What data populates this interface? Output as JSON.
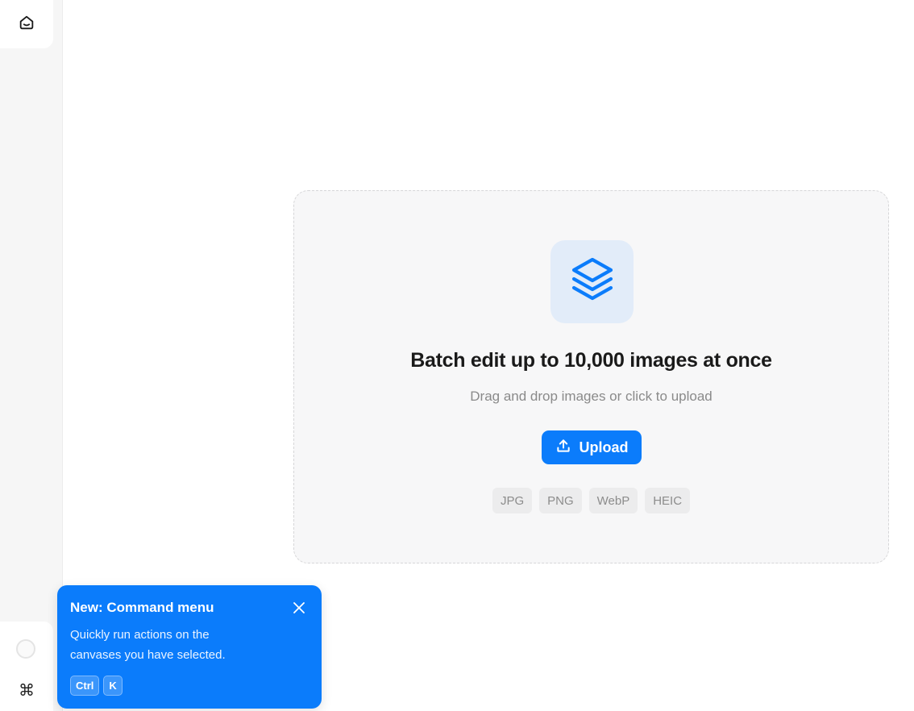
{
  "sidebar": {
    "home_icon": "home-icon",
    "status_icon": "status-ring-icon",
    "command_glyph": "⌘"
  },
  "dropzone": {
    "icon": "layers-icon",
    "title": "Batch edit up to 10,000 images at once",
    "subtitle": "Drag and drop images or click to upload",
    "upload_label": "Upload",
    "upload_icon": "upload-icon",
    "formats": [
      "JPG",
      "PNG",
      "WebP",
      "HEIC"
    ]
  },
  "toast": {
    "title": "New: Command menu",
    "body": "Quickly run actions on the canvases you have selected.",
    "keys": [
      "Ctrl",
      "K"
    ],
    "close_icon": "close-icon"
  },
  "colors": {
    "accent": "#0b7cfb",
    "icon_tile": "#e2ecf9",
    "dropzone_bg": "#f7f7f8"
  }
}
